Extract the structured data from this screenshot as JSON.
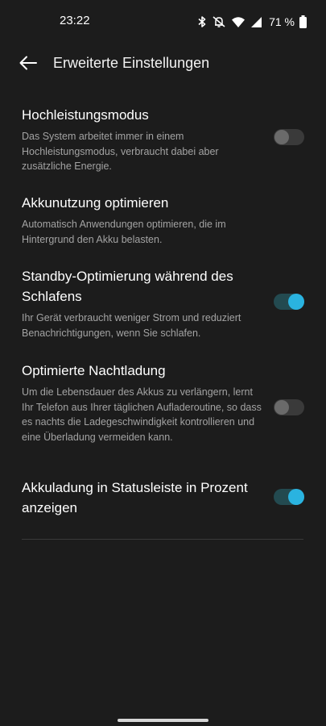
{
  "status_bar": {
    "time": "23:22",
    "battery_percent": "71 %",
    "icons": [
      "bluetooth-icon",
      "muted-bell-icon",
      "wifi-icon",
      "cell-signal-icon",
      "battery-icon"
    ]
  },
  "app_bar": {
    "back_icon": "arrow-left-icon",
    "title": "Erweiterte Einstellungen"
  },
  "settings": [
    {
      "title": "Hochleistungsmodus",
      "description": "Das System arbeitet immer in einem Hochleistungsmodus, verbraucht dabei aber zusätzliche Energie.",
      "toggle": "off"
    },
    {
      "title": "Akkunutzung optimieren",
      "description": "Automatisch Anwendungen optimieren, die im Hintergrund den Akku belasten."
    },
    {
      "title": "Standby-Optimierung während des Schlafens",
      "description": "Ihr Gerät verbraucht weniger Strom und reduziert Benachrichtigungen, wenn Sie schlafen.",
      "toggle": "on"
    },
    {
      "title": "Optimierte Nachtladung",
      "description": "Um die Lebensdauer des Akkus zu verlängern, lernt Ihr Telefon aus Ihrer täglichen Aufladeroutine, so dass es nachts die Ladegeschwindigkeit kontrollieren und eine Überladung vermeiden kann.",
      "toggle": "off"
    },
    {
      "title": "Akkuladung in Statusleiste in Prozent anzeigen",
      "toggle": "on"
    }
  ],
  "colors": {
    "background": "#1c1c1c",
    "accent": "#2ab3e0",
    "secondary_text": "#a3a3a3"
  }
}
